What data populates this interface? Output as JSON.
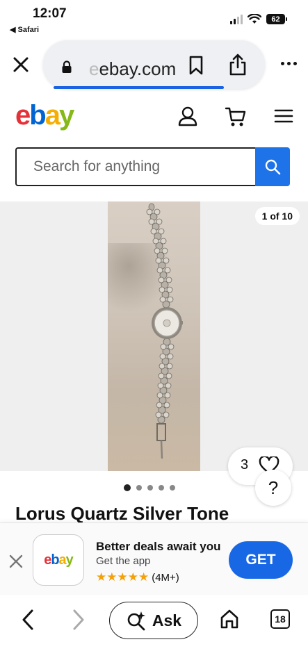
{
  "status_bar": {
    "time": "12:07",
    "back_app": "◀ Safari",
    "battery": "62"
  },
  "browser": {
    "url_domain": "ebay.com",
    "url_prefix": "e"
  },
  "header": {
    "brand": "ebay"
  },
  "search": {
    "placeholder": "Search for anything"
  },
  "gallery": {
    "counter": "1 of 10",
    "watch_count": "3",
    "help": "?",
    "total_dots": 5,
    "active_dot": 0
  },
  "listing": {
    "title": "Lorus Quartz Silver Tone"
  },
  "app_banner": {
    "title": "Better deals await you",
    "subtitle": "Get the app",
    "stars": "★★★★★",
    "rating_count": "(4M+)",
    "get_label": "GET"
  },
  "toolbar": {
    "ask_label": "Ask",
    "tab_count": "18"
  },
  "colors": {
    "accent": "#1f73e8",
    "get_button": "#1868e6",
    "star": "#f2a10b"
  }
}
